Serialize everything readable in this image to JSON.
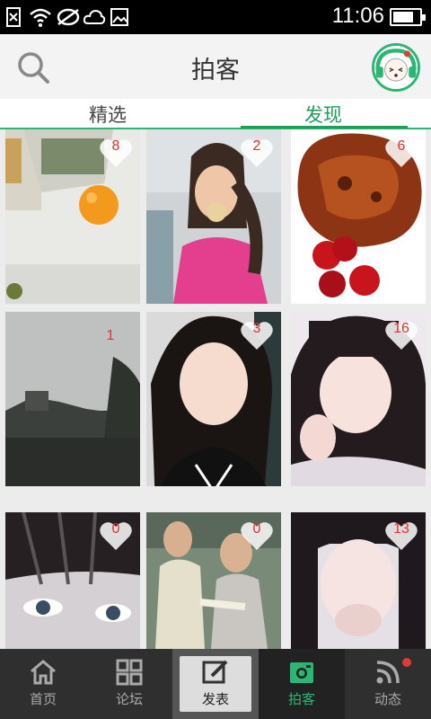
{
  "status_bar": {
    "time": "11:06",
    "battery_level": 0.8
  },
  "header": {
    "title": "拍客"
  },
  "tabs": [
    {
      "label": "精选",
      "active": false
    },
    {
      "label": "发现",
      "active": true
    }
  ],
  "photos": [
    {
      "likes": "8",
      "heart": true
    },
    {
      "likes": "2",
      "heart": true
    },
    {
      "likes": "6",
      "heart": true
    },
    {
      "likes": "1",
      "heart": false
    },
    {
      "likes": "3",
      "heart": true
    },
    {
      "likes": "16",
      "heart": true
    },
    {
      "likes": "0",
      "heart": true
    },
    {
      "likes": "0",
      "heart": true
    },
    {
      "likes": "13",
      "heart": true
    }
  ],
  "bottom_nav": [
    {
      "label": "首页",
      "icon": "home-icon"
    },
    {
      "label": "论坛",
      "icon": "grid-icon"
    },
    {
      "label": "发表",
      "icon": "edit-icon"
    },
    {
      "label": "拍客",
      "icon": "camera-icon"
    },
    {
      "label": "动态",
      "icon": "feed-icon"
    }
  ],
  "colors": {
    "accent": "#1e9e57",
    "like_count": "#dd3333",
    "nav_bg": "#2f2f2f"
  }
}
